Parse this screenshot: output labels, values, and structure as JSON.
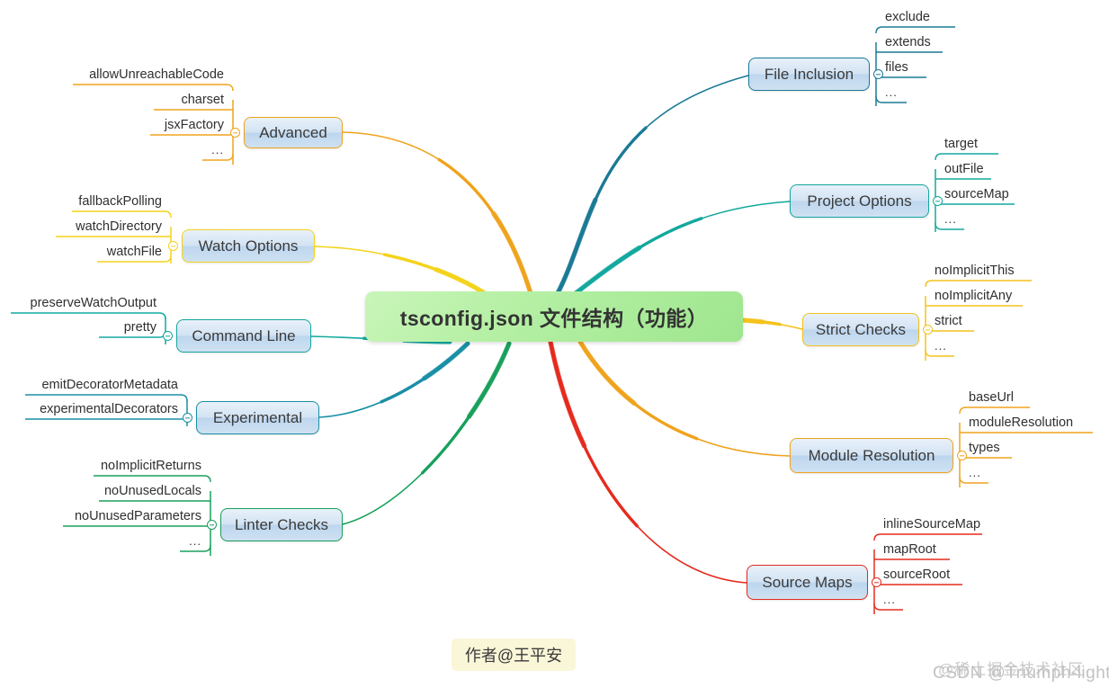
{
  "center": {
    "label": "tsconfig.json 文件结构（功能）",
    "color": "#9fe58e"
  },
  "branches": [
    {
      "id": "file-inclusion",
      "label": "File Inclusion",
      "color": "#1a7a96",
      "side": "right",
      "children": [
        "exclude",
        "extends",
        "files",
        "..."
      ]
    },
    {
      "id": "project-options",
      "label": "Project Options",
      "color": "#13a89e",
      "side": "right",
      "children": [
        "target",
        "outFile",
        "sourceMap",
        "..."
      ]
    },
    {
      "id": "strict-checks",
      "label": "Strict Checks",
      "color": "#f4c21b",
      "side": "right",
      "children": [
        "noImplicitThis",
        "noImplicitAny",
        "strict",
        "..."
      ]
    },
    {
      "id": "module-resolution",
      "label": "Module Resolution",
      "color": "#efa31d",
      "side": "right",
      "children": [
        "baseUrl",
        "moduleResolution",
        "types",
        "..."
      ]
    },
    {
      "id": "source-maps",
      "label": "Source Maps",
      "color": "#e52b1e",
      "side": "right",
      "children": [
        "inlineSourceMap",
        "mapRoot",
        "sourceRoot",
        "..."
      ]
    },
    {
      "id": "advanced",
      "label": "Advanced",
      "color": "#efa31d",
      "side": "left",
      "children": [
        "allowUnreachableCode",
        "charset",
        "jsxFactory",
        "..."
      ]
    },
    {
      "id": "watch-options",
      "label": "Watch Options",
      "color": "#f4d31b",
      "side": "left",
      "children": [
        "fallbackPolling",
        "watchDirectory",
        "watchFile"
      ]
    },
    {
      "id": "command-line",
      "label": "Command Line",
      "color": "#13a8a0",
      "side": "left",
      "children": [
        "preserveWatchOutput",
        "pretty"
      ]
    },
    {
      "id": "experimental",
      "label": "Experimental",
      "color": "#1a8fa6",
      "side": "left",
      "children": [
        "emitDecoratorMetadata",
        "experimentalDecorators"
      ]
    },
    {
      "id": "linter-checks",
      "label": "Linter Checks",
      "color": "#18a05c",
      "side": "left",
      "children": [
        "noImplicitReturns",
        "noUnusedLocals",
        "noUnusedParameters",
        "..."
      ]
    }
  ],
  "author": {
    "label": "作者@王平安"
  },
  "watermarks": {
    "top": "@稀土掘金技术社区",
    "bottom": "CSDN @Triumph-light"
  }
}
